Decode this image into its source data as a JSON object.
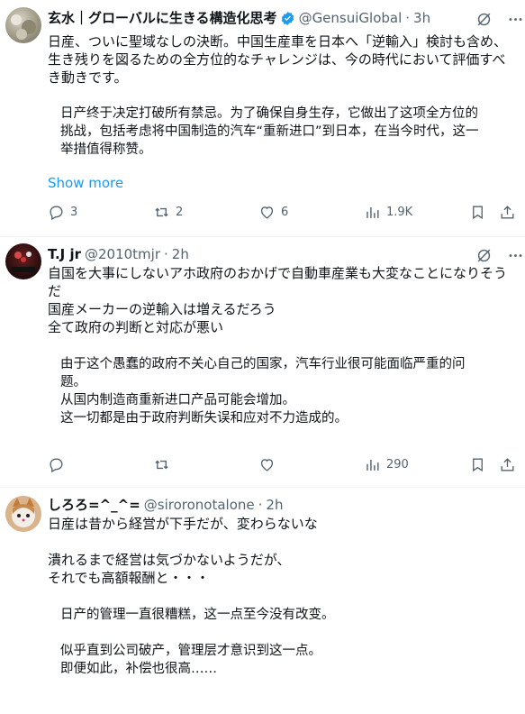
{
  "posts": [
    {
      "name": "玄水｜グローバルに生きる構造化思考",
      "handle": "@GensuiGlobal",
      "time": "3h",
      "text": "日産、ついに聖域なしの決断。中国生産車を日本へ「逆輸入」検討も含め、\n生き残りを図るための全方位的なチャレンジは、今の時代において評価すべ\nき動きです。",
      "translation": "日产终于决定打破所有禁忌。为了确保自身生存，它做出了这项全方位的\n挑战，包括考虑将中国制造的汽车“重新进口”到日本，在当今时代，这一\n举措值得称赞。",
      "show_more": "Show more",
      "replies": "3",
      "reposts": "2",
      "likes": "6",
      "views": "1.9K"
    },
    {
      "name": "T.J jr",
      "handle": "@2010tmjr",
      "time": "2h",
      "text": "自国を大事にしないアホ政府のおかげで自動車産業も大変なことになりそう\nだ\n国産メーカーの逆輸入は増えるだろう\n全て政府の判断と対応が悪い",
      "translation": "由于这个愚蠢的政府不关心自己的国家，汽车行业很可能面临严重的问\n题。\n从国内制造商重新进口产品可能会增加。\n这一切都是由于政府判断失误和应对不力造成的。",
      "replies": "",
      "reposts": "",
      "likes": "",
      "views": "290"
    },
    {
      "name": "しろろ=^_^=",
      "handle": "@sirorono​talone",
      "time": "2h",
      "text": "日産は昔から経営が下手だが、変わらないな\n\n潰れるまで経営は気づかないようだが、\nそれでも高額報酬と・・・",
      "translation": "日产的管理一直很糟糕，这一点至今没有改变。\n\n似乎直到公司破产，管理层才意识到这一点。\n即便如此，补偿也很高……"
    }
  ],
  "colors": {
    "accent": "#1d9bf0",
    "muted": "#536471",
    "text": "#0f1419"
  }
}
